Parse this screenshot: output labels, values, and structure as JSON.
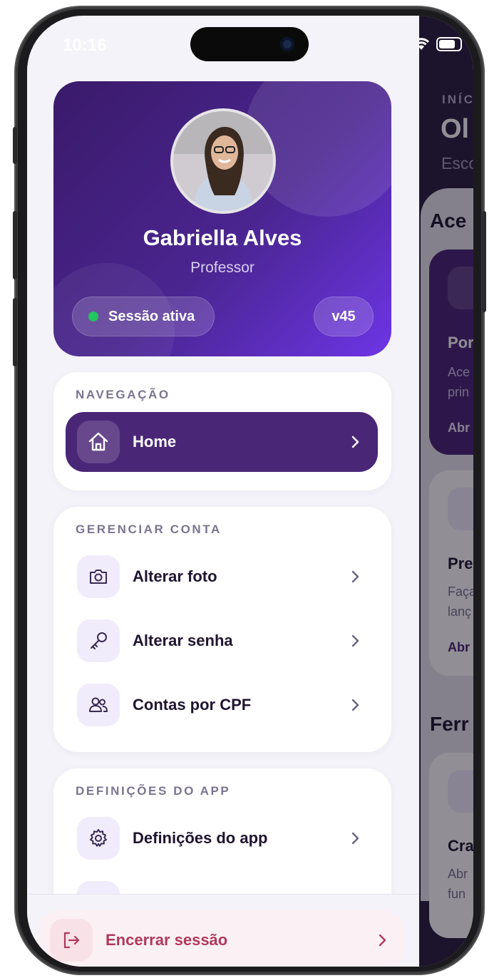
{
  "status_bar": {
    "time": "10:16"
  },
  "profile": {
    "name": "Gabriella Alves",
    "role": "Professor",
    "session_status": "Sessão ativa",
    "version": "v45"
  },
  "navigation": {
    "title": "NAVEGAÇÃO",
    "items": [
      {
        "label": "Home",
        "icon": "home-icon",
        "active": true
      }
    ]
  },
  "account": {
    "title": "GERENCIAR CONTA",
    "items": [
      {
        "label": "Alterar foto",
        "icon": "camera-icon"
      },
      {
        "label": "Alterar senha",
        "icon": "key-icon"
      },
      {
        "label": "Contas por CPF",
        "icon": "users-icon"
      }
    ]
  },
  "app_settings": {
    "title": "DEFINIÇÕES DO APP",
    "items": [
      {
        "label": "Definições do app",
        "icon": "gear-icon"
      }
    ]
  },
  "logout": {
    "label": "Encerrar sessão",
    "icon": "logout-icon"
  },
  "background_app": {
    "eyebrow": "INÍC",
    "heading": "Ol",
    "subheading": "Esco",
    "section1": "Ace",
    "card1_title": "Por",
    "card1_desc": [
      "Ace",
      "prin"
    ],
    "card1_link": "Abr",
    "card2_title": "Pre",
    "card2_desc": [
      "Faça",
      "lanç"
    ],
    "card2_link": "Abr",
    "section2": "Ferr",
    "card3_title": "Cra",
    "card3_desc": [
      "Abr",
      "fun"
    ]
  },
  "colors": {
    "accent": "#4a2677",
    "gradient_start": "#3a1a6a",
    "gradient_end": "#6d35e6",
    "logout": "#b0385e",
    "status_active": "#22c55e"
  }
}
